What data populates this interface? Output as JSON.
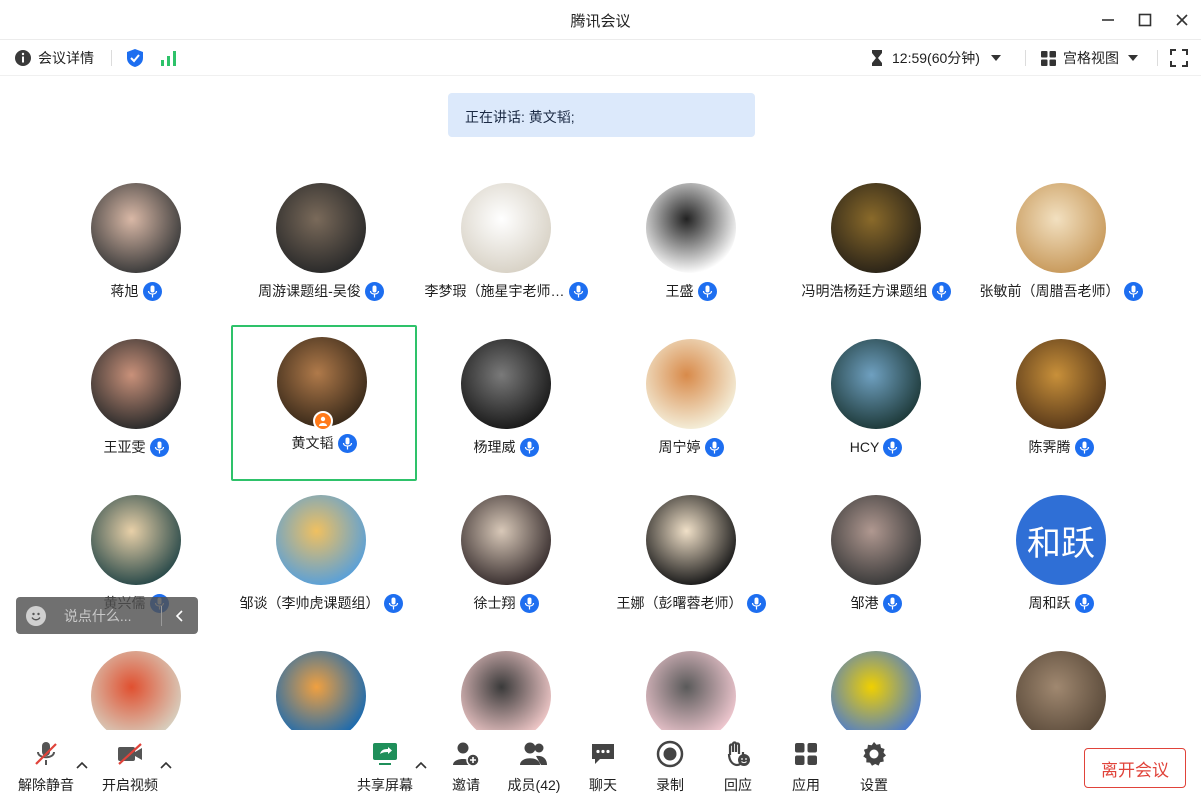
{
  "window": {
    "title": "腾讯会议"
  },
  "infobar": {
    "details_label": "会议详情",
    "timer": "12:59(60分钟)",
    "view_label": "宫格视图"
  },
  "speaking": {
    "text": "正在讲话: 黄文韬;"
  },
  "participants": [
    {
      "name": "蒋旭",
      "avatar": "photo"
    },
    {
      "name": "周游课题组-吴俊",
      "avatar": "photo"
    },
    {
      "name": "李梦瑕（施星宇老师…",
      "avatar": "photo"
    },
    {
      "name": "王盛",
      "avatar": "drawing"
    },
    {
      "name": "冯明浩杨廷方课题组",
      "avatar": "photo"
    },
    {
      "name": "张敏前（周腊吾老师）",
      "avatar": "photo"
    },
    {
      "name": "王亚雯",
      "avatar": "photo"
    },
    {
      "name": "黄文韬",
      "avatar": "photo",
      "host": true,
      "active": true
    },
    {
      "name": "杨理威",
      "avatar": "photo"
    },
    {
      "name": "周宁婷",
      "avatar": "cat"
    },
    {
      "name": "HCY",
      "avatar": "photo"
    },
    {
      "name": "陈霁腾",
      "avatar": "photo"
    },
    {
      "name": "黄兴儒",
      "avatar": "photo"
    },
    {
      "name": "邹谈（李帅虎课题组）",
      "avatar": "photo"
    },
    {
      "name": "徐士翔",
      "avatar": "photo"
    },
    {
      "name": "王娜（彭曙蓉老师）",
      "avatar": "photo"
    },
    {
      "name": "邹港",
      "avatar": "photo"
    },
    {
      "name": "周和跃",
      "avatar": "text",
      "avatar_text": "和跃"
    },
    {
      "name": "",
      "avatar": "photo"
    },
    {
      "name": "",
      "avatar": "photo"
    },
    {
      "name": "",
      "avatar": "photo"
    },
    {
      "name": "",
      "avatar": "photo"
    },
    {
      "name": "",
      "avatar": "photo"
    },
    {
      "name": "",
      "avatar": "photo"
    }
  ],
  "chat": {
    "placeholder": "说点什么..."
  },
  "toolbar": {
    "unmute": "解除静音",
    "start_video": "开启视频",
    "share_screen": "共享屏幕",
    "invite": "邀请",
    "members": "成员(42)",
    "chat": "聊天",
    "record": "录制",
    "react": "回应",
    "apps": "应用",
    "settings": "设置",
    "leave": "离开会议"
  },
  "colors": {
    "accent": "#1d6ef0",
    "active_border": "#2ec26a",
    "leave": "#e0433a",
    "signal": "#2ec26a",
    "text_avatar_bg": "#2f6fd6"
  }
}
